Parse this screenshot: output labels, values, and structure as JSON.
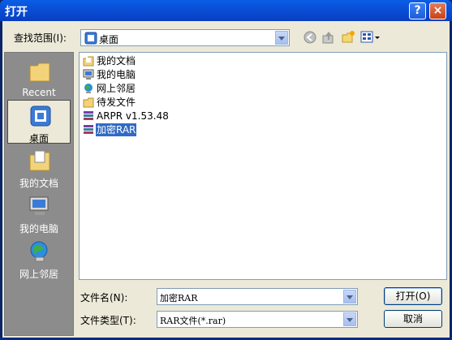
{
  "window": {
    "title": "打开",
    "help_label": "?",
    "close_label": "×"
  },
  "lookin": {
    "label": "查找范围(I):",
    "value": "桌面"
  },
  "places": [
    {
      "label": "Recent",
      "icon": "recent-folder-icon",
      "selected": false
    },
    {
      "label": "桌面",
      "icon": "desktop-icon",
      "selected": true
    },
    {
      "label": "我的文档",
      "icon": "my-documents-icon",
      "selected": false
    },
    {
      "label": "我的电脑",
      "icon": "my-computer-icon",
      "selected": false
    },
    {
      "label": "网上邻居",
      "icon": "network-places-icon",
      "selected": false
    }
  ],
  "files": [
    {
      "name": "我的文档",
      "icon": "my-documents-icon",
      "selected": false
    },
    {
      "name": "我的电脑",
      "icon": "my-computer-icon",
      "selected": false
    },
    {
      "name": "网上邻居",
      "icon": "network-places-icon",
      "selected": false
    },
    {
      "name": "待发文件",
      "icon": "folder-icon",
      "selected": false
    },
    {
      "name": "ARPR v1.53.48",
      "icon": "archive-icon",
      "selected": false
    },
    {
      "name": "加密RAR",
      "icon": "archive-icon",
      "selected": true
    }
  ],
  "filename": {
    "label": "文件名(N):",
    "value": "加密RAR"
  },
  "filetype": {
    "label": "文件类型(T):",
    "value": "RAR文件(*.rar)"
  },
  "buttons": {
    "open": "打开(O)",
    "cancel": "取消"
  },
  "colors": {
    "title_bar": "#0a4fd8",
    "selection": "#316ac5",
    "places_bg": "#8c8c8c",
    "dialog_bg": "#ece9d8"
  }
}
